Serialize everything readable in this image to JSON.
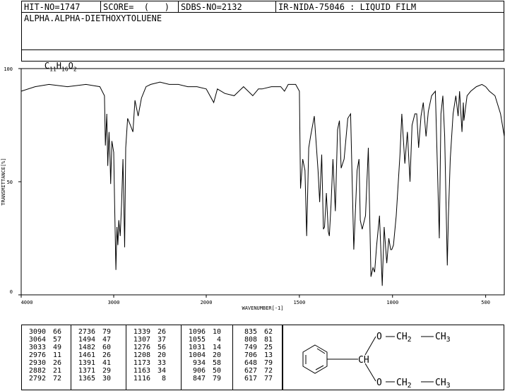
{
  "header": {
    "hit_no": "HIT-NO=1747",
    "score": "SCORE=  (   )",
    "sdbs_no": "SDBS-NO=2132",
    "ir_nida": "IR-NIDA-75046 : LIQUID FILM"
  },
  "compound_name": "ALPHA.ALPHA-DIETHOXYTOLUENE",
  "formula": {
    "c": "C",
    "c_sub": "11",
    "h": "H",
    "h_sub": "16",
    "o": "O",
    "o_sub": "2"
  },
  "chart_data": {
    "type": "line",
    "xlabel": "WAVENUMBER[-1]",
    "ylabel": "TRANSMITTANCE[%]",
    "xlim": [
      4000,
      400
    ],
    "ylim": [
      0,
      100
    ],
    "x_ticks": [
      "4000",
      "3000",
      "2000",
      "1500",
      "1000",
      "500"
    ],
    "y_ticks": [
      "100",
      "50",
      "0"
    ],
    "series": [
      {
        "x": [
          4000,
          3850,
          3700,
          3500,
          3300,
          3150,
          3100,
          3090,
          3075,
          3064,
          3050,
          3040,
          3033,
          3020,
          3000,
          2990,
          2976,
          2965,
          2955,
          2945,
          2930,
          2915,
          2900,
          2882,
          2870,
          2850,
          2820,
          2792,
          2770,
          2736,
          2700,
          2650,
          2600,
          2500,
          2400,
          2300,
          2200,
          2100,
          2000,
          1960,
          1940,
          1900,
          1850,
          1800,
          1750,
          1720,
          1700,
          1650,
          1600,
          1580,
          1560,
          1520,
          1500,
          1494,
          1482,
          1470,
          1461,
          1450,
          1440,
          1420,
          1400,
          1391,
          1380,
          1371,
          1365,
          1355,
          1345,
          1339,
          1330,
          1320,
          1307,
          1295,
          1285,
          1276,
          1260,
          1240,
          1225,
          1208,
          1190,
          1180,
          1173,
          1163,
          1145,
          1130,
          1116,
          1105,
          1096,
          1085,
          1070,
          1055,
          1045,
          1031,
          1020,
          1010,
          1004,
          995,
          980,
          960,
          950,
          934,
          920,
          906,
          895,
          880,
          870,
          860,
          847,
          835,
          820,
          808,
          790,
          770,
          749,
          740,
          730,
          720,
          706,
          700,
          690,
          675,
          660,
          648,
          640,
          627,
          620,
          617,
          600,
          580,
          550,
          520,
          500,
          480,
          450,
          420,
          400
        ],
        "y": [
          90,
          92,
          93,
          92,
          93,
          92,
          88,
          66,
          80,
          57,
          72,
          60,
          49,
          68,
          63,
          40,
          11,
          30,
          22,
          33,
          26,
          40,
          60,
          21,
          65,
          78,
          75,
          72,
          86,
          79,
          87,
          92,
          93,
          94,
          93,
          93,
          92,
          92,
          91,
          85,
          91,
          89,
          88,
          92,
          88,
          91,
          91,
          92,
          92,
          90,
          93,
          93,
          90,
          47,
          60,
          55,
          26,
          65,
          70,
          79,
          55,
          41,
          62,
          29,
          30,
          45,
          28,
          26,
          40,
          60,
          37,
          73,
          77,
          56,
          60,
          78,
          80,
          20,
          55,
          60,
          33,
          29,
          35,
          65,
          8,
          12,
          10,
          22,
          35,
          4,
          30,
          14,
          25,
          20,
          20,
          22,
          35,
          62,
          80,
          58,
          72,
          50,
          75,
          80,
          80,
          65,
          79,
          85,
          70,
          81,
          88,
          90,
          25,
          80,
          88,
          70,
          13,
          35,
          60,
          80,
          88,
          79,
          90,
          72,
          85,
          77,
          88,
          90,
          92,
          93,
          92,
          90,
          88,
          80,
          70
        ]
      }
    ]
  },
  "peak_table": [
    [
      [
        "3090",
        "66"
      ],
      [
        "3064",
        "57"
      ],
      [
        "3033",
        "49"
      ],
      [
        "2976",
        "11"
      ],
      [
        "2930",
        "26"
      ],
      [
        "2882",
        "21"
      ],
      [
        "2792",
        "72"
      ]
    ],
    [
      [
        "2736",
        "79"
      ],
      [
        "1494",
        "47"
      ],
      [
        "1482",
        "60"
      ],
      [
        "1461",
        "26"
      ],
      [
        "1391",
        "41"
      ],
      [
        "1371",
        "29"
      ],
      [
        "1365",
        "30"
      ]
    ],
    [
      [
        "1339",
        "26"
      ],
      [
        "1307",
        "37"
      ],
      [
        "1276",
        "56"
      ],
      [
        "1208",
        "20"
      ],
      [
        "1173",
        "33"
      ],
      [
        "1163",
        "34"
      ],
      [
        "1116",
        "8"
      ]
    ],
    [
      [
        "1096",
        "10"
      ],
      [
        "1055",
        "4"
      ],
      [
        "1031",
        "14"
      ],
      [
        "1004",
        "20"
      ],
      [
        "934",
        "58"
      ],
      [
        "906",
        "50"
      ],
      [
        "847",
        "79"
      ]
    ],
    [
      [
        "835",
        "62"
      ],
      [
        "808",
        "81"
      ],
      [
        "749",
        "25"
      ],
      [
        "706",
        "13"
      ],
      [
        "648",
        "79"
      ],
      [
        "627",
        "72"
      ],
      [
        "617",
        "77"
      ]
    ]
  ],
  "structure": {
    "o_top": "O",
    "ch2_top": "CH",
    "ch2_top_sub": "2",
    "ch3_top": "CH",
    "ch3_top_sub": "3",
    "ch": "CH",
    "o_bot": "O",
    "ch2_bot": "CH",
    "ch2_bot_sub": "2",
    "ch3_bot": "CH",
    "ch3_bot_sub": "3"
  }
}
